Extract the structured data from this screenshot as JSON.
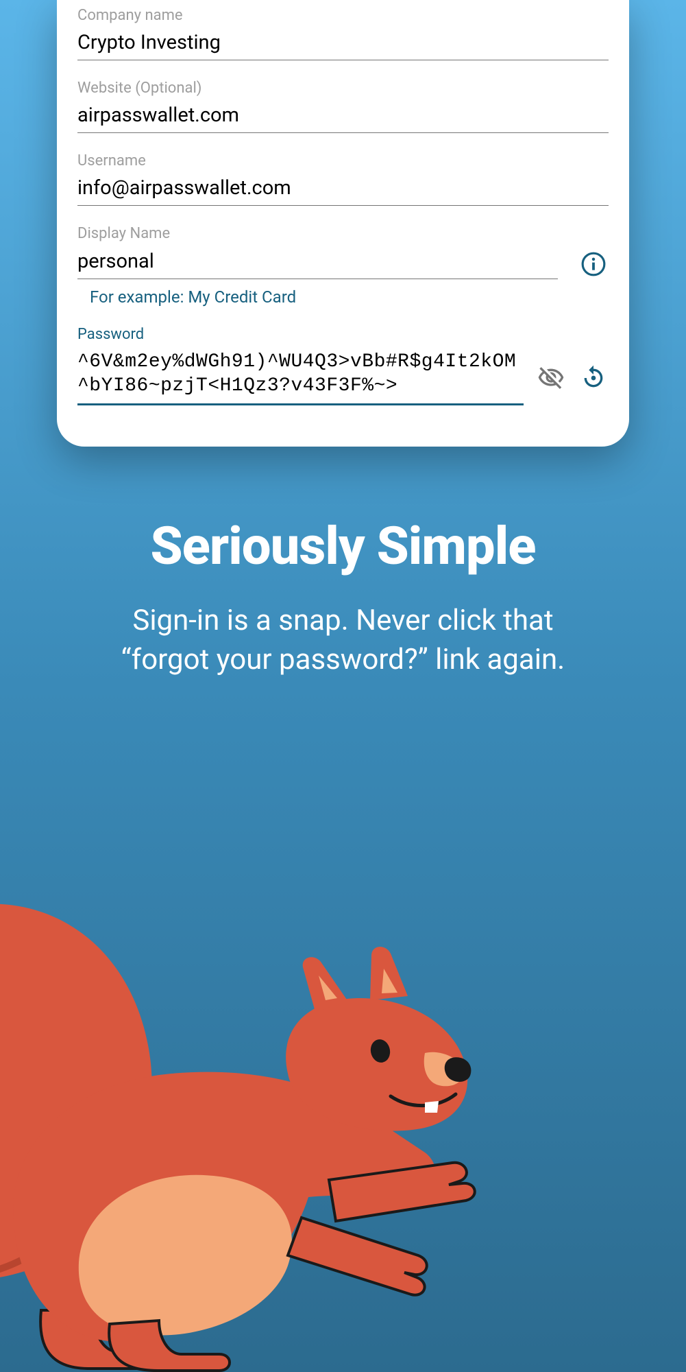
{
  "form": {
    "company": {
      "label": "Company name",
      "value": "Crypto Investing"
    },
    "website": {
      "label": "Website (Optional)",
      "value": "airpasswallet.com"
    },
    "username": {
      "label": "Username",
      "value": "info@airpasswallet.com"
    },
    "displayName": {
      "label": "Display Name",
      "value": "personal",
      "hint": "For example: My Credit Card"
    },
    "password": {
      "label": "Password",
      "value": "^6V&m2ey%dWGh91)^WU4Q3>vBb#R$g4It2kOM^bYI86~pzjT<H1Qz3?v43F3F%~>"
    }
  },
  "hero": {
    "title": "Seriously Simple",
    "subtitle": "Sign-in is a snap. Never click that “forgot your password?” link again."
  }
}
